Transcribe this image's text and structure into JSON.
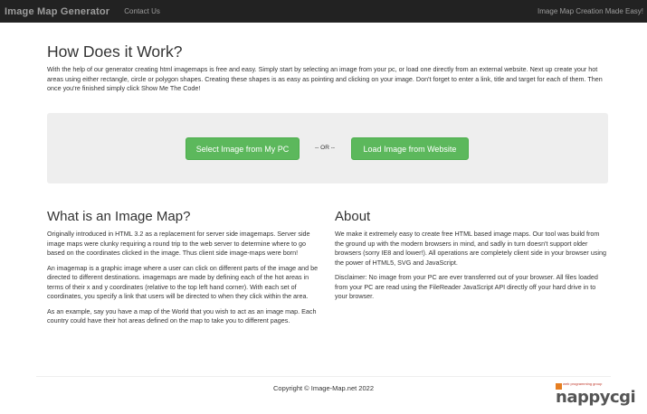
{
  "navbar": {
    "brand": "Image Map Generator",
    "contact": "Contact Us",
    "tagline": "Image Map Creation Made Easy!"
  },
  "how": {
    "title": "How Does it Work?",
    "text": "With the help of our generator creating html imagemaps is free and easy. Simply start by selecting an image from your pc, or load one directly from an external website. Next up create your hot areas using either rectangle, circle or polygon shapes. Creating these shapes is as easy as pointing and clicking on your image. Don't forget to enter a link, title and target for each of them. Then once you're finished simply click Show Me The Code!"
  },
  "actions": {
    "select_label": "Select Image from My PC",
    "or_label": "-- OR --",
    "load_label": "Load Image from Website"
  },
  "what": {
    "title": "What is an Image Map?",
    "p1": "Originally introduced in HTML 3.2 as a replacement for server side imagemaps. Server side image maps were clunky requiring a round trip to the web server to determine where to go based on the coordinates clicked in the image. Thus client side image-maps were born!",
    "p2": "An imagemap is a graphic image where a user can click on different parts of the image and be directed to different destinations. imagemaps are made by defining each of the hot areas in terms of their x and y coordinates (relative to the top left hand corner). With each set of coordinates, you specify a link that users will be directed to when they click within the area.",
    "p3": "As an example, say you have a map of the World that you wish to act as an image map. Each country could have their hot areas defined on the map to take you to different pages."
  },
  "about": {
    "title": "About",
    "p1": "We make it extremely easy to create free HTML based image maps. Our tool was build from the ground up with the modern browsers in mind, and sadly in turn doesn't support older browsers (sorry IE8 and lower!). All operations are completely client side in your browser using the power of HTML5, SVG and JavaScript.",
    "p2": "Disclaimer: No image from your PC are ever transferred out of your browser. All files loaded from your PC are read using the FileReader JavaScript API directly off your hard drive in to your browser."
  },
  "footer": {
    "copyright": "Copyright © Image-Map.net 2022"
  },
  "logo": {
    "small": "web programming group",
    "big": "nappycgi"
  },
  "colors": {
    "navbar_bg": "#222222",
    "button_green": "#5cb85c",
    "jumbotron_bg": "#eeeeee"
  }
}
